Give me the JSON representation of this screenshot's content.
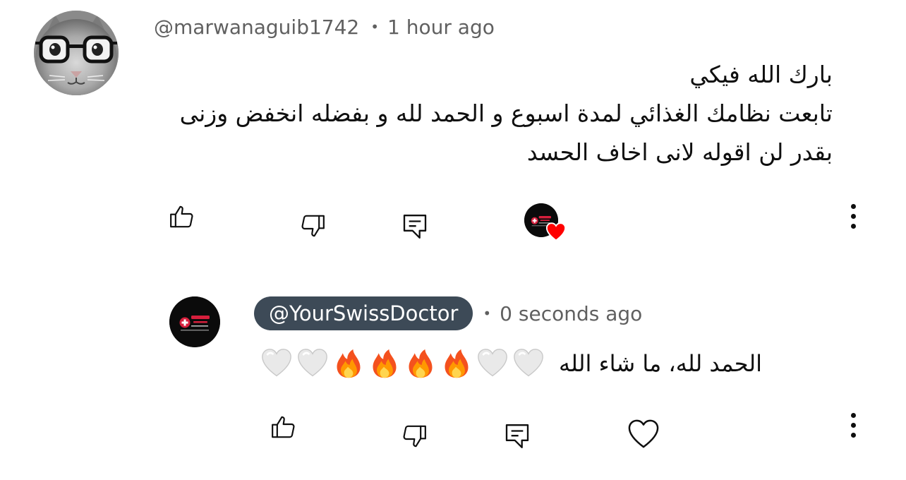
{
  "comment": {
    "author": "@marwanaguib1742",
    "time": "1 hour ago",
    "lines": [
      "بارك الله فيكي",
      "تابعت نظامك الغذائي لمدة اسبوع و الحمد لله و بفضله انخفض وزنى",
      "بقدر لن اقوله لانى اخاف الحسد"
    ],
    "icons": {
      "like": "thumbs-up-icon",
      "dislike": "thumbs-down-icon",
      "reply": "reply-icon",
      "creator_heart": "creator-heart-icon",
      "menu": "more-vertical-icon"
    }
  },
  "reply": {
    "author": "@YourSwissDoctor",
    "time": "0 seconds ago",
    "text": "الحمد لله، ما شاء الله",
    "emojis": [
      "white-heart",
      "white-heart",
      "fire",
      "fire",
      "fire",
      "fire",
      "white-heart",
      "white-heart"
    ],
    "icons": {
      "like": "thumbs-up-icon",
      "dislike": "thumbs-down-icon",
      "reply": "reply-icon",
      "heart": "heart-outline-icon",
      "menu": "more-vertical-icon"
    }
  },
  "colors": {
    "text": "#0f0f0f",
    "secondary": "#606060",
    "handle_chip_bg": "#3d4a57",
    "heart_red": "#ff0000",
    "avatar_dark": "#0b0b0b",
    "logo_accent": "#d61f3c"
  }
}
